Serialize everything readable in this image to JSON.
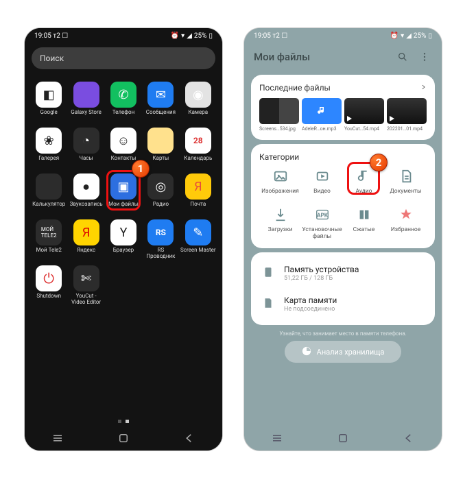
{
  "status": {
    "time": "19:05",
    "carrier": "т2",
    "battery": "25%"
  },
  "left": {
    "search_placeholder": "Поиск",
    "apps": [
      {
        "label": "Google",
        "name": "app-google",
        "cls": "i-white",
        "glyph": "◧"
      },
      {
        "label": "Galaxy Store",
        "name": "app-galaxy-store",
        "cls": "i-purple",
        "glyph": ""
      },
      {
        "label": "Телефон",
        "name": "app-phone",
        "cls": "i-green",
        "glyph": "✆"
      },
      {
        "label": "Сообщения",
        "name": "app-messages",
        "cls": "i-blue",
        "glyph": "✉"
      },
      {
        "label": "Камера",
        "name": "app-camera",
        "cls": "i-grey",
        "glyph": "◉"
      },
      {
        "label": "Галерея",
        "name": "app-gallery",
        "cls": "i-white",
        "glyph": "❀"
      },
      {
        "label": "Часы",
        "name": "app-clock",
        "cls": "i-dark",
        "glyph": "◔"
      },
      {
        "label": "Контакты",
        "name": "app-contacts",
        "cls": "i-white",
        "glyph": "☺"
      },
      {
        "label": "Карты",
        "name": "app-maps",
        "cls": "i-ysoft",
        "glyph": ""
      },
      {
        "label": "Календарь",
        "name": "app-calendar",
        "cls": "i-white",
        "glyph": "28"
      },
      {
        "label": "Калькулятор",
        "name": "app-calculator",
        "cls": "i-dark",
        "glyph": ""
      },
      {
        "label": "Звукозапись",
        "name": "app-recorder",
        "cls": "i-white",
        "glyph": "●"
      },
      {
        "label": "Мои файлы",
        "name": "app-my-files",
        "cls": "i-bluetile",
        "glyph": "▣"
      },
      {
        "label": "Радио",
        "name": "app-radio",
        "cls": "i-dark",
        "glyph": "◎"
      },
      {
        "label": "Почта",
        "name": "app-mail",
        "cls": "i-yel",
        "glyph": "Я"
      },
      {
        "label": "Мой Tele2",
        "name": "app-tele2",
        "cls": "i-dark",
        "glyph": ""
      },
      {
        "label": "Яндекс",
        "name": "app-yandex",
        "cls": "i-yb",
        "glyph": "Я"
      },
      {
        "label": "Браузер",
        "name": "app-browser",
        "cls": "i-white",
        "glyph": "Y"
      },
      {
        "label": "RS Проводник",
        "name": "app-rs-explorer",
        "cls": "i-blue",
        "glyph": "RS"
      },
      {
        "label": "Screen Master",
        "name": "app-screen-master",
        "cls": "i-blue",
        "glyph": "✎"
      },
      {
        "label": "Shutdown",
        "name": "app-shutdown",
        "cls": "i-white",
        "glyph": "⏻"
      },
      {
        "label": "YouCut - Video Editor",
        "name": "app-youcut",
        "cls": "i-dark",
        "glyph": "✄"
      }
    ],
    "marker": "1",
    "highlight_index": 12
  },
  "right": {
    "title": "Мои файлы",
    "recent": {
      "header": "Последние файлы",
      "items": [
        {
          "caption": "Screens…534.jpg",
          "kind": "img"
        },
        {
          "caption": "AdeleR…он.mp3",
          "kind": "music"
        },
        {
          "caption": "YouCut…54.mp4",
          "kind": "vid"
        },
        {
          "caption": "202201…01.mp4",
          "kind": "vid"
        }
      ]
    },
    "categories": {
      "header": "Категории",
      "items": [
        {
          "label": "Изображения",
          "name": "cat-images",
          "glyph": "img"
        },
        {
          "label": "Видео",
          "name": "cat-video",
          "glyph": "vid"
        },
        {
          "label": "Аудио",
          "name": "cat-audio",
          "glyph": "aud"
        },
        {
          "label": "Документы",
          "name": "cat-documents",
          "glyph": "doc"
        },
        {
          "label": "Загрузки",
          "name": "cat-downloads",
          "glyph": "dl"
        },
        {
          "label": "Установочные файлы",
          "name": "cat-apk",
          "glyph": "apk"
        },
        {
          "label": "Сжатые",
          "name": "cat-archives",
          "glyph": "zip"
        },
        {
          "label": "Избранное",
          "name": "cat-favorites",
          "glyph": "fav"
        }
      ],
      "highlight_index": 2,
      "marker": "2"
    },
    "storage": [
      {
        "title": "Память устройства",
        "sub": "51,22 ГБ / 128 ГБ",
        "name": "storage-internal"
      },
      {
        "title": "Карта памяти",
        "sub": "Не подсоединено",
        "name": "storage-sdcard"
      }
    ],
    "hint": "Узнайте, что занимает место в памяти телефона.",
    "analyse": "Анализ хранилища"
  }
}
